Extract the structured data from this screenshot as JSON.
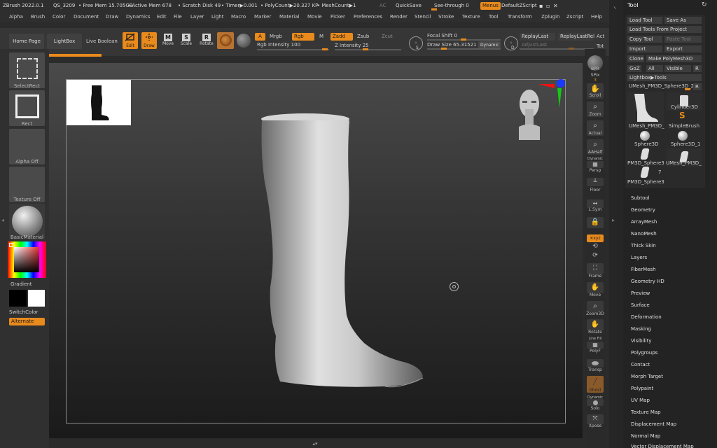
{
  "status": {
    "app": "ZBrush 2022.0.1",
    "qs": "QS_3209",
    "free_mem": "• Free Mem 15.705GB",
    "active_mem": "• Active Mem 678",
    "scratch": "• Scratch Disk 49",
    "timer": "• Timer▶0.001",
    "polycount": "• PolyCount▶20.327 KP",
    "meshcount": "• MeshCount▶1",
    "ac": "AC",
    "quicksave": "QuickSave",
    "see_through": "See-through  0",
    "menus": "Menus",
    "default_zscript": "DefaultZScript"
  },
  "menus": [
    "Alpha",
    "Brush",
    "Color",
    "Document",
    "Draw",
    "Dynamics",
    "Edit",
    "File",
    "Layer",
    "Light",
    "Macro",
    "Marker",
    "Material",
    "Movie",
    "Picker",
    "Preferences",
    "Render",
    "Stencil",
    "Stroke",
    "Texture",
    "Tool",
    "Transform",
    "Zplugin",
    "Zscript",
    "Help"
  ],
  "toolbar": {
    "home_page": "Home Page",
    "lightbox": "LightBox",
    "live_boolean": "Live Boolean",
    "edit": "Edit",
    "draw": "Draw",
    "move": "Move",
    "scale": "Scale",
    "rotate": "Rotate",
    "a": "A",
    "mrgb": "Mrgb",
    "rgb": "Rgb",
    "m": "M",
    "zadd": "Zadd",
    "zsub": "Zsub",
    "zcut": "Zcut",
    "rgb_intensity": "Rgb Intensity 100",
    "z_intensity": "Z Intensity 25",
    "focal_shift": "Focal Shift 0",
    "draw_size": "Draw Size  65.31521",
    "dynamic": "Dynamic",
    "replay_last": "ReplayLast",
    "replay_last_rel": "ReplayLastRel",
    "act": "Act",
    "adjust_last": "AdjustLast",
    "tot": "Tot",
    "s_label": "S",
    "d_label": "D"
  },
  "left_shelf": {
    "select_rect": "SelectRect",
    "rect": "Rect",
    "alpha_off": "Alpha Off",
    "texture_off": "Texture Off",
    "basic_material": "BasicMaterial",
    "gradient": "Gradient",
    "switch_color": "SwitchColor",
    "alternate": "Alternate"
  },
  "right_shelf": {
    "bpr": "BPR",
    "spix": "SPix",
    "spix_val": "3",
    "scroll": "Scroll",
    "zoom": "Zoom",
    "actual": "Actual",
    "aahalf": "AAHalf",
    "dynamic": "Dynamic",
    "persp": "Persp",
    "floor": "Floor",
    "lsym": "L.Sym",
    "xyz": "✕xyz",
    "frame": "Frame",
    "move": "Move",
    "zoom3d": "Zoom3D",
    "rotate": "Rotate",
    "line_fill": "Line Fill",
    "polyf": "PolyF",
    "transp": "Transp",
    "ghost": "Ghost",
    "dynamic2": "Dynamic",
    "solo": "Solo",
    "xpose": "Xpose"
  },
  "tool": {
    "title": "Tool",
    "load_tool": "Load Tool",
    "save_as": "Save As",
    "load_from_project": "Load Tools From Project",
    "copy_tool": "Copy Tool",
    "paste_tool": "Paste Tool",
    "import": "Import",
    "export": "Export",
    "clone": "Clone",
    "make_polymesh": "Make PolyMesh3D",
    "goz": "GoZ",
    "all": "All",
    "visible": "Visible",
    "r": "R",
    "lightbox_tools": "Lightbox▶Tools",
    "current_tool": "UMesh_PM3D_Sphere3D_2",
    "r2": "R",
    "thumbs": [
      {
        "name": "UMesh_PM3D_"
      },
      {
        "name": "Cylinder3D"
      },
      {
        "name": "SimpleBrush"
      },
      {
        "name": "Sphere3D"
      },
      {
        "name": "Sphere3D_1"
      },
      {
        "name": "PM3D_Sphere3"
      },
      {
        "name": "UMesh_PM3D_"
      },
      {
        "name": "PM3D_Sphere3"
      }
    ],
    "thumb_count": "7",
    "subpalettes": [
      "Subtool",
      "Geometry",
      "ArrayMesh",
      "NanoMesh",
      "Thick Skin",
      "Layers",
      "FiberMesh",
      "Geometry HD",
      "Preview",
      "Surface",
      "Deformation",
      "Masking",
      "Visibility",
      "Polygroups",
      "Contact",
      "Morph Target",
      "Polypaint",
      "UV Map",
      "Texture Map",
      "Displacement Map",
      "Normal Map",
      "Vector Displacement Map"
    ]
  },
  "colors": {
    "accent": "#e88a1c",
    "panel": "#2b2b2b"
  }
}
